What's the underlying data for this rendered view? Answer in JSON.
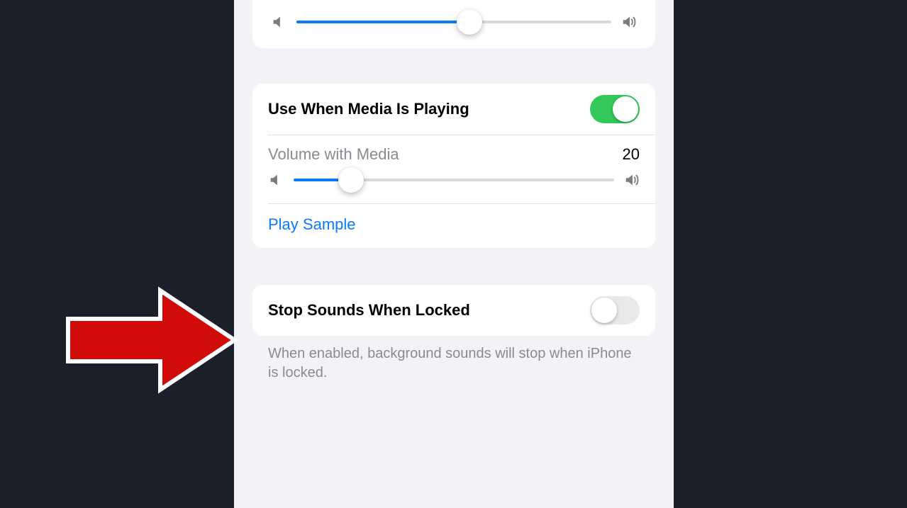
{
  "topSlider": {
    "percent": 55
  },
  "media": {
    "toggleLabel": "Use When Media Is Playing",
    "toggleOn": true,
    "volumeLabel": "Volume with Media",
    "volumeValue": "20",
    "volumePercent": 18,
    "playSample": "Play Sample"
  },
  "lock": {
    "label": "Stop Sounds When Locked",
    "toggleOn": false,
    "footer": "When enabled, background sounds will stop when iPhone is locked."
  }
}
